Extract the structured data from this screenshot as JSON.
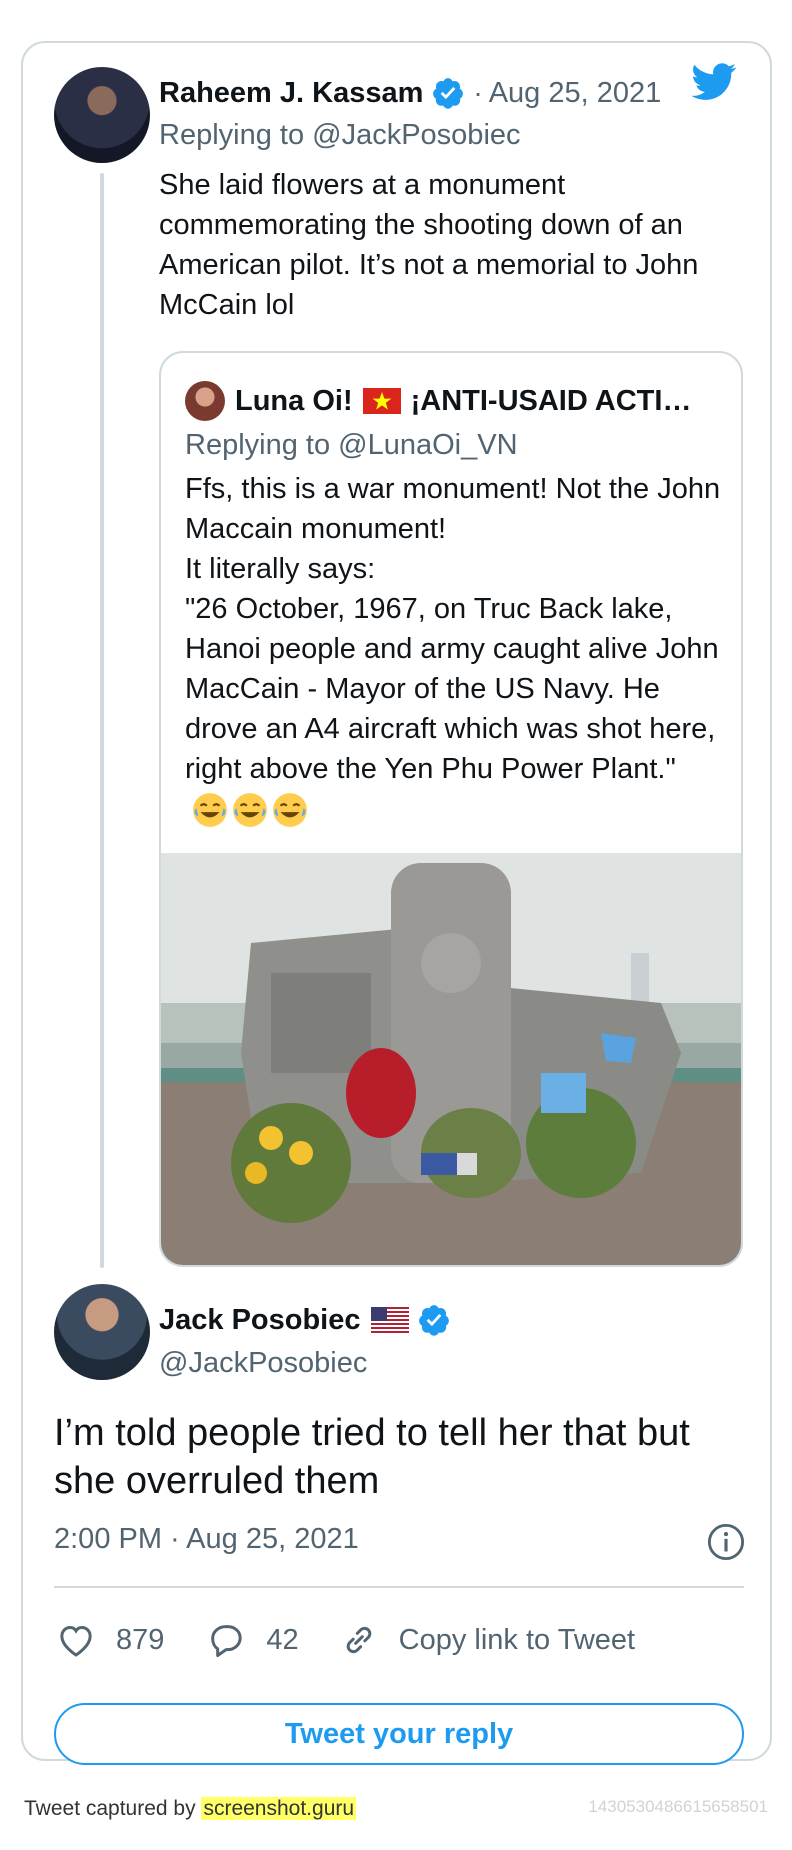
{
  "parent_tweet": {
    "author_name": "Raheem J. Kassam",
    "separator": "·",
    "date": "Aug 25, 2021",
    "replying_to": "Replying to @JackPosobiec",
    "text": "She laid flowers at a monument commemorating the shooting down of an American pilot. It’s not a memorial to John McCain lol"
  },
  "quoted_tweet": {
    "author_name": "Luna Oi!",
    "author_name_tail": "¡ANTI-USAID ACTI…",
    "replying_to": "Replying to @LunaOi_VN",
    "text": "Ffs, this is a war monument! Not the John Maccain monument!\nIt literally says:\n\"26 October, 1967, on Truc Back lake, Hanoi people and army caught alive John MacCain - Mayor of the US Navy. He drove an A4 aircraft which was shot here, right above the Yen Phu Power Plant.\"",
    "emoji": [
      "face-with-tears-of-joy",
      "face-with-tears-of-joy",
      "face-with-tears-of-joy"
    ],
    "image": "war-monument-with-flowers-photo"
  },
  "main_tweet": {
    "author_name": "Jack Posobiec",
    "handle": "@JackPosobiec",
    "text": "I’m told people tried to tell her that but she overruled them",
    "timestamp": "2:00 PM · Aug 25, 2021",
    "likes": "879",
    "replies": "42",
    "copy_link_label": "Copy link to Tweet",
    "reply_button_label": "Tweet your reply"
  },
  "footer": {
    "captured_by": "Tweet captured by",
    "site": "screenshot.guru",
    "tweet_id": "1430530486615658501"
  },
  "colors": {
    "accent": "#1d9bf0",
    "secondary_text": "#536471",
    "border": "#cfd9de"
  }
}
